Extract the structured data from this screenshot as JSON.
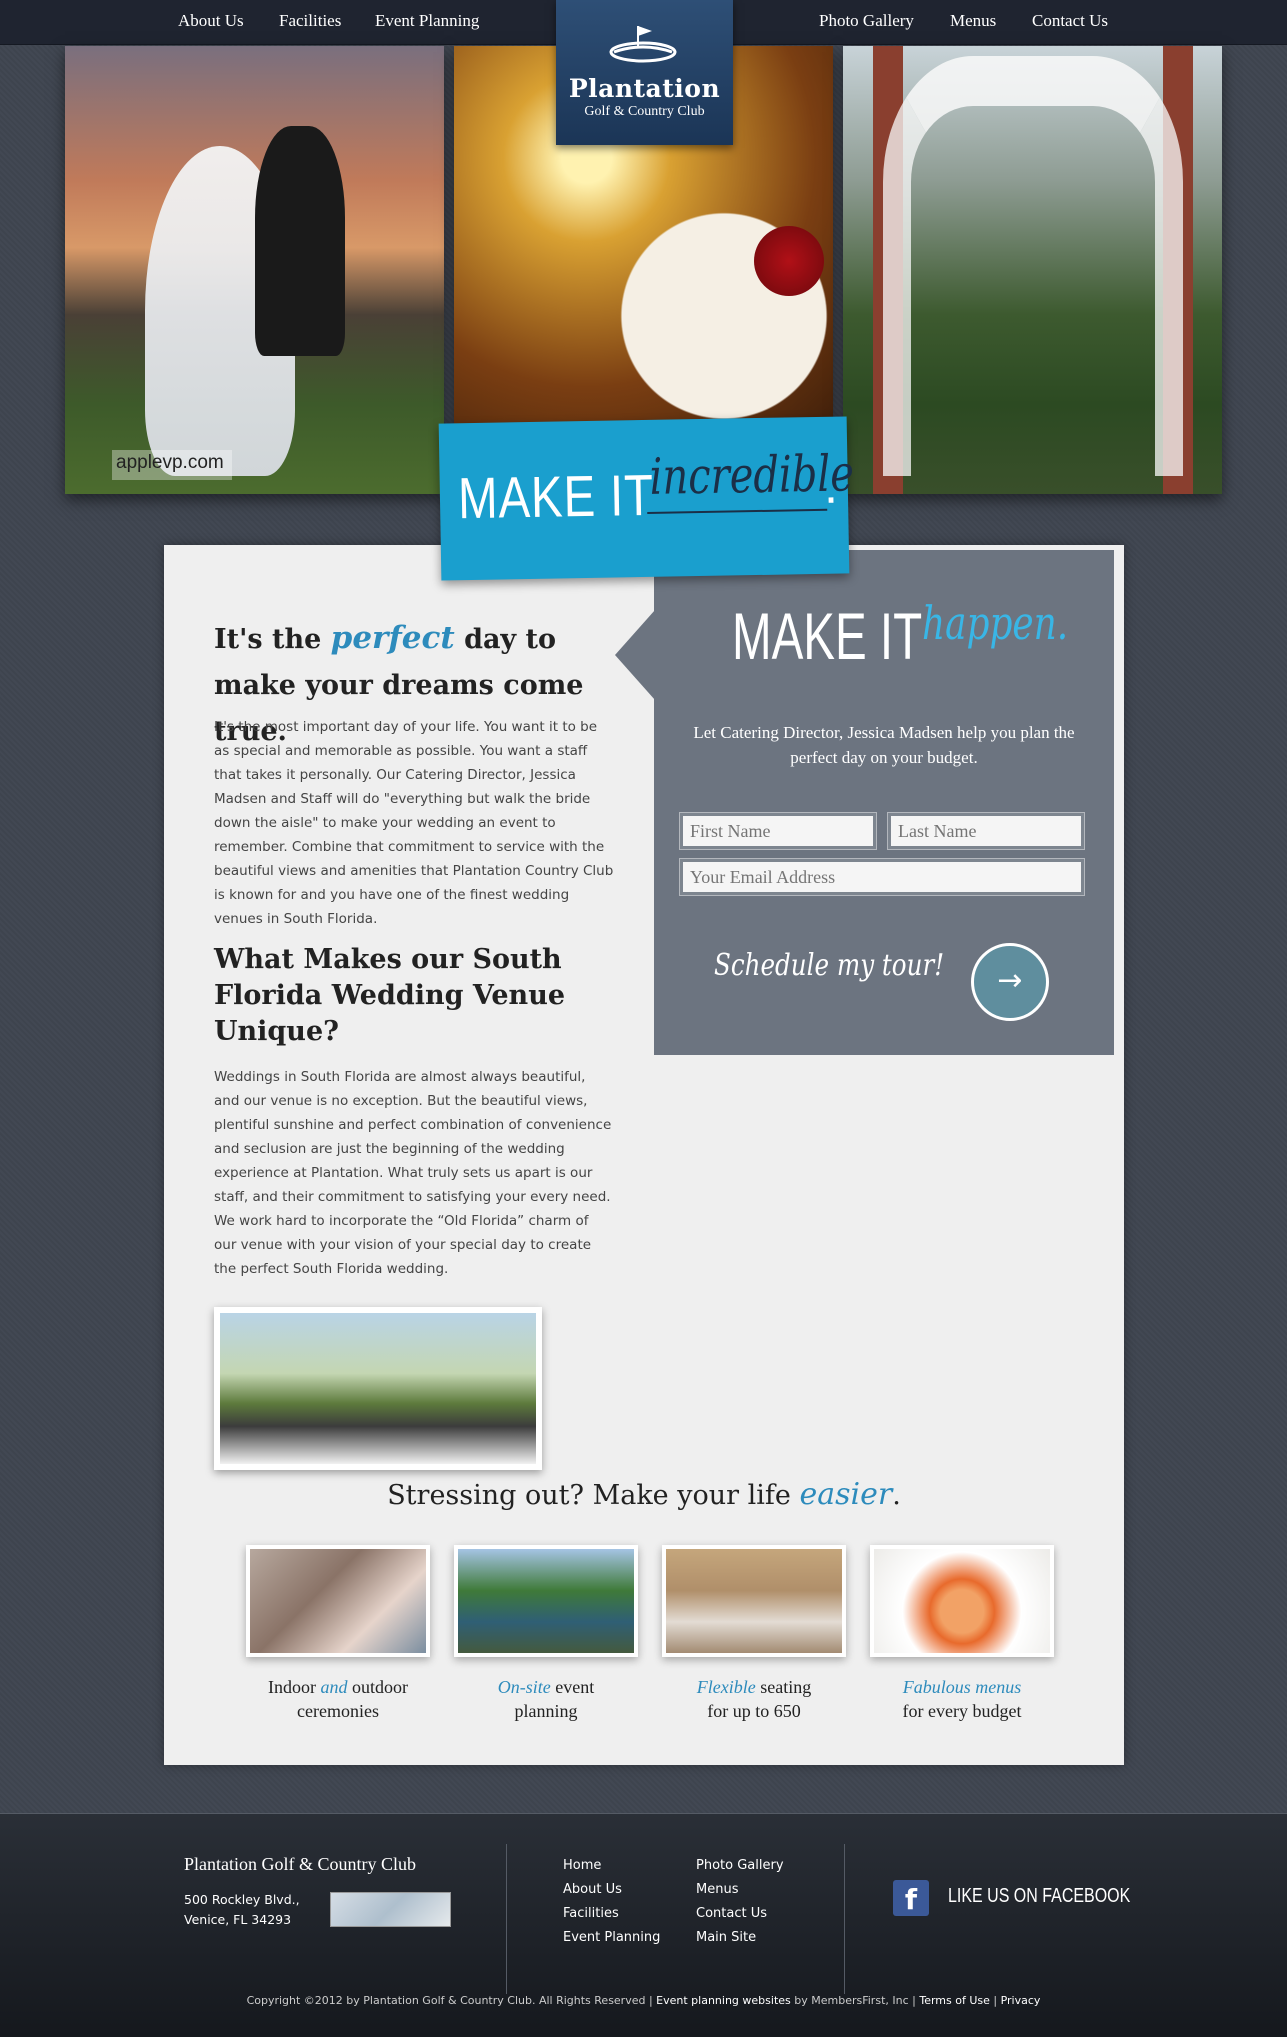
{
  "nav": {
    "about": "About Us",
    "facilities": "Facilities",
    "event_planning": "Event Planning",
    "gallery": "Photo Gallery",
    "menus": "Menus",
    "contact": "Contact Us"
  },
  "logo": {
    "title": "Plantation",
    "subtitle": "Golf & Country Club"
  },
  "hero": {
    "watermark": "applevp.com"
  },
  "banner": {
    "part1": "MAKE IT",
    "part2": "incredible",
    "dot": "."
  },
  "intro": {
    "title_a": "It's the",
    "title_script": "perfect",
    "title_b": "day to make your dreams come true.",
    "paragraph": "It's the most important day of your life. You want it to be as special and memorable as possible. You want a staff that takes it personally. Our Catering Director, Jessica Madsen and Staff will do \"everything but walk the bride down the aisle\" to make your wedding an event to remember. Combine that commitment to service with the beautiful views and amenities that Plantation Country Club is known for and you have one of the finest wedding venues in South Florida."
  },
  "unique": {
    "title": "What Makes our South Florida Wedding Venue Unique?",
    "paragraph": "Weddings in South Florida are almost always beautiful, and our venue is no exception. But the beautiful views, plentiful sunshine and perfect combination of convenience and seclusion are just the beginning of the wedding experience at Plantation. What truly sets us apart is our staff, and their commitment to satisfying your every need. We work hard to incorporate the “Old Florida” charm of our venue with your vision of your special day to create the perfect South Florida wedding."
  },
  "form": {
    "head1": "MAKE IT",
    "head2": "happen.",
    "desc": "Let Catering Director, Jessica Madsen help you plan the perfect day on your budget.",
    "first_name_placeholder": "First Name",
    "last_name_placeholder": "Last Name",
    "email_placeholder": "Your Email Address",
    "schedule": "Schedule my tour!",
    "button_glyph": "→"
  },
  "stress": {
    "a": "Stressing out? Make your life",
    "script": "easier",
    "b": "."
  },
  "features": [
    {
      "a": "Indoor ",
      "script": "and",
      "b": " outdoor",
      "c": "ceremonies"
    },
    {
      "a": "",
      "script": "On-site",
      "b": " event",
      "c": "planning"
    },
    {
      "a": "",
      "script": "Flexible",
      "b": " seating",
      "c": "for up to 650"
    },
    {
      "a": "",
      "script": "Fabulous menus",
      "b": "",
      "c": "for every budget"
    }
  ],
  "footer": {
    "name": "Plantation Golf & Country Club",
    "addr1": "500 Rockley Blvd.,",
    "addr2": "Venice, FL 34293",
    "col1": [
      "Home",
      "About Us",
      "Facilities",
      "Event Planning"
    ],
    "col2": [
      "Photo Gallery",
      "Menus",
      "Contact Us",
      "Main Site"
    ],
    "facebook_letter": "f",
    "facebook": "LIKE US ON FACEBOOK",
    "copyright": "Copyright ©2012 by Plantation Golf & Country Club. All Rights Reserved",
    "sep": " | ",
    "ep_a": "Event planning websites",
    "ep_b": " by MembersFirst, Inc",
    "terms": "Terms of Use",
    "privacy": "Privacy"
  },
  "colors": {
    "accent_blue": "#1a9fce",
    "script_blue": "#2d8bbc",
    "form_gray": "#6c7480",
    "nav_dark": "#1f2430"
  }
}
